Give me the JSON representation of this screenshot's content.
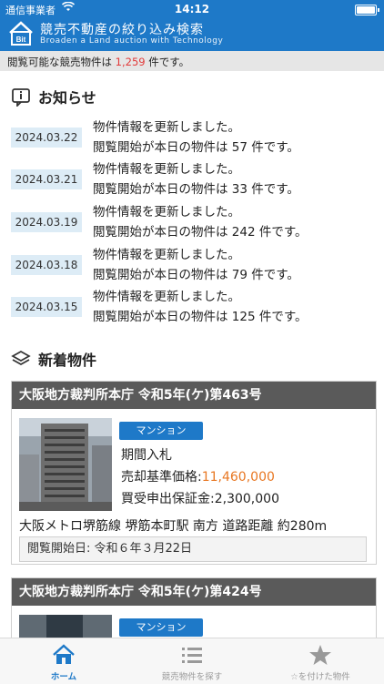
{
  "status": {
    "carrier": "通信事業者",
    "time": "14:12"
  },
  "header": {
    "title": "競売不動産の絞り込み検索",
    "subtitle": "Broaden a Land auction with Technology",
    "logo_text": "Bit"
  },
  "count": {
    "prefix": "閲覧可能な競売物件は ",
    "number": "1,259",
    "suffix": " 件です。"
  },
  "news": {
    "title": "お知らせ",
    "items": [
      {
        "date": "2024.03.22",
        "line1": "物件情報を更新しました。",
        "line2": "閲覧開始が本日の物件は 57 件です。"
      },
      {
        "date": "2024.03.21",
        "line1": "物件情報を更新しました。",
        "line2": "閲覧開始が本日の物件は 33 件です。"
      },
      {
        "date": "2024.03.19",
        "line1": "物件情報を更新しました。",
        "line2": "閲覧開始が本日の物件は 242 件です。"
      },
      {
        "date": "2024.03.18",
        "line1": "物件情報を更新しました。",
        "line2": "閲覧開始が本日の物件は 79 件です。"
      },
      {
        "date": "2024.03.15",
        "line1": "物件情報を更新しました。",
        "line2": "閲覧開始が本日の物件は 125 件です。"
      }
    ]
  },
  "new_items": {
    "title": "新着物件",
    "cards": [
      {
        "heading": "大阪地方裁判所本庁 令和5年(ケ)第463号",
        "type": "マンション",
        "method": "期間入札",
        "price_label": "売却基準価格:",
        "price": "11,460,000",
        "deposit_label": "買受申出保証金:",
        "deposit": "2,300,000",
        "access": "大阪メトロ堺筋線 堺筋本町駅 南方 道路距離 約280m",
        "open_date": "閲覧開始日: 令和６年３月22日"
      },
      {
        "heading": "大阪地方裁判所本庁 令和5年(ケ)第424号",
        "type": "マンション"
      }
    ]
  },
  "tabs": [
    {
      "label": "ホーム",
      "icon": "home-icon"
    },
    {
      "label": "競売物件を探す",
      "icon": "list-icon"
    },
    {
      "label": "☆を付けた物件",
      "icon": "star-icon"
    }
  ],
  "colors": {
    "brand": "#1e79c8",
    "price": "#e87722",
    "count": "#e23a3a"
  }
}
